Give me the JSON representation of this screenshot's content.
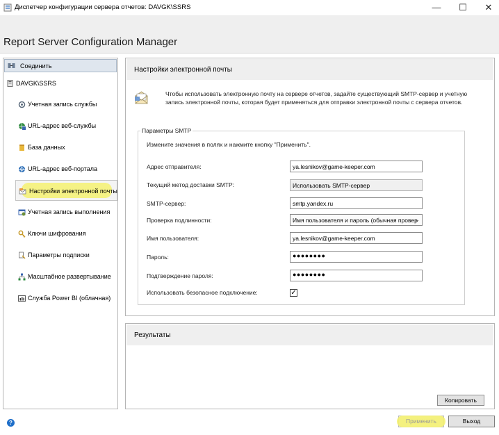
{
  "window": {
    "title": "Диспетчер конфигурации сервера отчетов: DAVGK\\SSRS",
    "minimize": "—",
    "maximize": "☐",
    "close": "✕"
  },
  "header": {
    "app_title": "Report Server Configuration Manager"
  },
  "sidebar": {
    "connect_label": "Соединить",
    "server": "DAVGK\\SSRS",
    "items": [
      {
        "label": "Учетная запись службы",
        "icon": "service-account-icon"
      },
      {
        "label": "URL-адрес веб-службы",
        "icon": "web-service-url-icon"
      },
      {
        "label": "База данных",
        "icon": "database-icon"
      },
      {
        "label": "URL-адрес веб-портала",
        "icon": "web-portal-url-icon"
      },
      {
        "label": "Настройки электронной почты",
        "icon": "email-settings-icon",
        "selected": true
      },
      {
        "label": "Учетная запись выполнения",
        "icon": "execution-account-icon"
      },
      {
        "label": "Ключи шифрования",
        "icon": "encryption-keys-icon"
      },
      {
        "label": "Параметры подписки",
        "icon": "subscription-settings-icon"
      },
      {
        "label": "Масштабное развертывание",
        "icon": "scale-out-icon"
      },
      {
        "label": "Служба Power BI (облачная)",
        "icon": "power-bi-icon"
      }
    ]
  },
  "email": {
    "heading": "Настройки электронной почты",
    "description": "Чтобы использовать электронную почту на сервере отчетов, задайте существующий SMTP-сервер и учетную запись электронной почты, которая будет применяться для отправки электронной почты с сервера отчетов.",
    "group_title": "Параметры SMTP",
    "hint": "Измените значения в полях и нажмите кнопку \"Применить\".",
    "sender_label": "Адрес отправителя:",
    "sender_value": "ya.lesnikov@game-keeper.com",
    "method_label": "Текущий метод доставки SMTP:",
    "method_value": "Использовать SMTP-сервер",
    "server_label": "SMTP-сервер:",
    "server_value": "smtp.yandex.ru",
    "auth_label": "Проверка подлинности:",
    "auth_value": "Имя пользователя и пароль (обычная провер",
    "user_label": "Имя пользователя:",
    "user_value": "ya.lesnikov@game-keeper.com",
    "password_label": "Пароль:",
    "password_value": "●●●●●●●●",
    "confirm_label": "Подтверждение пароля:",
    "confirm_value": "●●●●●●●●",
    "secure_label": "Использовать безопасное подключение:",
    "secure_checked": true,
    "check_mark": "✓"
  },
  "results": {
    "heading": "Результаты",
    "copy_label": "Копировать"
  },
  "footer": {
    "help": "?",
    "apply_label": "Применить",
    "exit_label": "Выход"
  },
  "colors": {
    "highlight": "#f4f171",
    "section_header": "#efefef",
    "accent_blue": "#1f6fc9"
  }
}
